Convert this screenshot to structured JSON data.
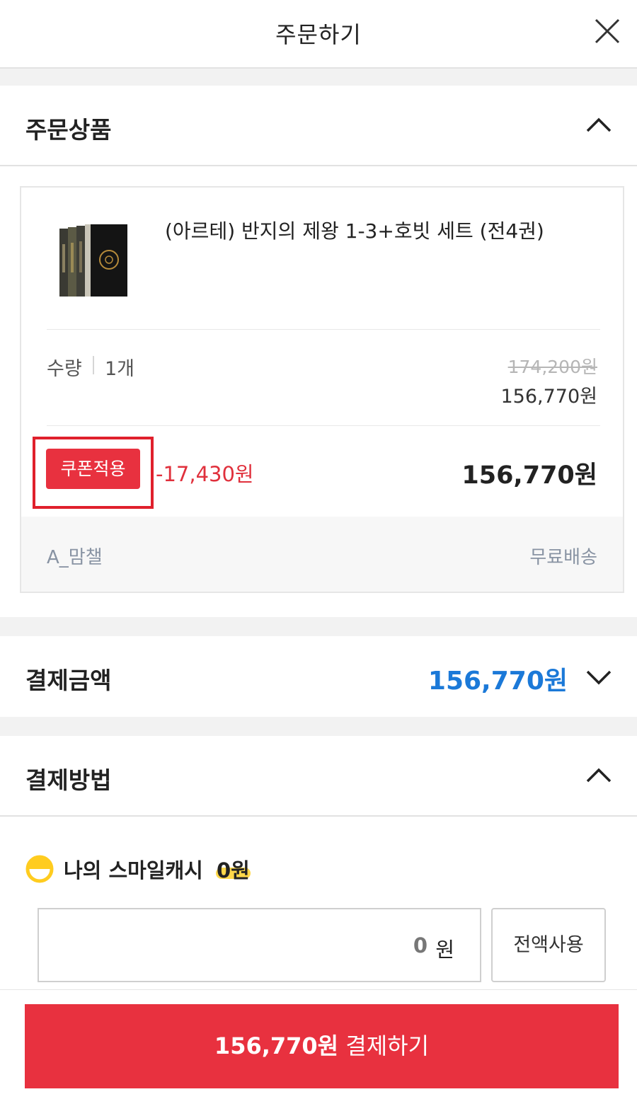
{
  "header": {
    "title": "주문하기",
    "close_icon": "close-icon"
  },
  "order_items": {
    "title": "주문상품",
    "toggle_icon": "chevron-up-icon",
    "product": {
      "name": "(아르테) 반지의 제왕 1-3+호빗 세트 (전4권)",
      "thumbnail_icon": "book-box-set-image",
      "quantity_label": "수량",
      "quantity_value": "1개",
      "original_price": "174,200원",
      "sale_price": "156,770원",
      "coupon_label": "쿠폰적용",
      "coupon_discount": "-17,430원",
      "final_price": "156,770원",
      "seller": "A_맘챌",
      "shipping": "무료배송"
    }
  },
  "payment_amount": {
    "title": "결제금액",
    "amount": "156,770원",
    "toggle_icon": "chevron-down-icon"
  },
  "payment_method": {
    "title": "결제방법",
    "toggle_icon": "chevron-up-icon",
    "smile_cash": {
      "label": "나의 스마일캐시",
      "amount": "0원",
      "input_value": "0",
      "input_unit": "원",
      "use_all_label": "전액사용"
    }
  },
  "pay_button": {
    "amount": "156,770원",
    "label": "결제하기"
  },
  "colors": {
    "accent_red": "#e8313f",
    "amount_blue": "#1b79d8",
    "cash_yellow": "#ffd84a"
  }
}
